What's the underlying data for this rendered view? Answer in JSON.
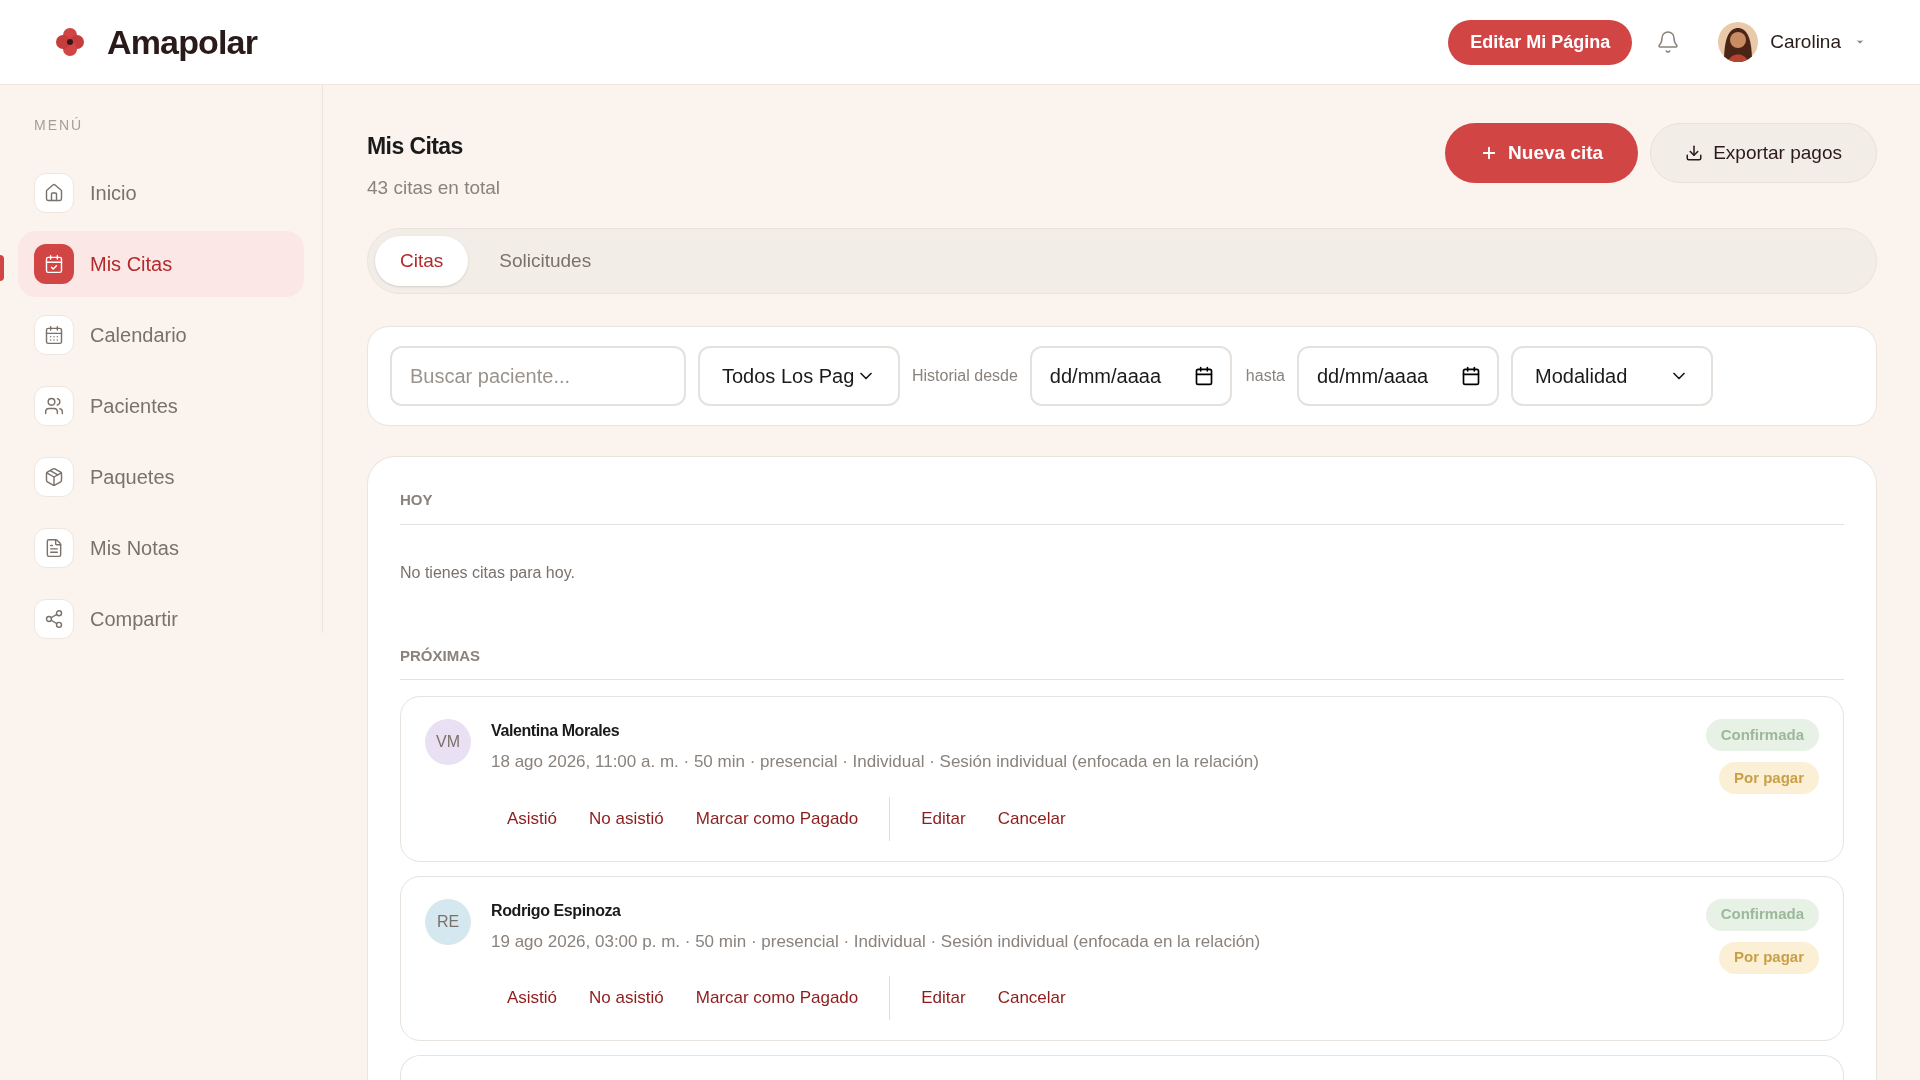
{
  "brand": {
    "name": "Amapolar"
  },
  "header": {
    "edit_button": "Editar Mi Página",
    "user": {
      "name": "Carolina"
    }
  },
  "sidebar": {
    "heading": "MENÚ",
    "items": [
      {
        "label": "Inicio",
        "selected": false
      },
      {
        "label": "Mis Citas",
        "selected": true
      },
      {
        "label": "Calendario",
        "selected": false
      },
      {
        "label": "Pacientes",
        "selected": false
      },
      {
        "label": "Paquetes",
        "selected": false
      },
      {
        "label": "Mis Notas",
        "selected": false
      },
      {
        "label": "Compartir",
        "selected": false
      }
    ]
  },
  "page": {
    "title": "Mis Citas",
    "subtitle": "43 citas en total",
    "new_button": "Nueva cita",
    "export_button": "Exportar pagos"
  },
  "tabs": [
    {
      "label": "Citas",
      "selected": true
    },
    {
      "label": "Solicitudes",
      "selected": false
    }
  ],
  "filters": {
    "search": {
      "placeholder": "Buscar paciente..."
    },
    "payment_select": "Todos Los Pag",
    "from_label": "Historial desde",
    "from_date": {
      "placeholder": "dd/mm/aaaa"
    },
    "to_label": "hasta",
    "to_date": {
      "placeholder": "dd/mm/aaaa"
    },
    "mode_select": "Modalidad"
  },
  "today": {
    "heading": "HOY",
    "empty_text": "No tienes citas para hoy."
  },
  "upcoming": {
    "heading": "PRÓXIMAS",
    "appointments": [
      {
        "initials": "VM",
        "color": "#e9e0f3",
        "name": "Valentina Morales",
        "details": "18 ago 2026, 11:00 a. m. · 50 min · presencial · Individual · Sesión individual (enfocada en la relación)",
        "badges": [
          {
            "label": "Confirmada",
            "kind": "status"
          },
          {
            "label": "Por pagar",
            "kind": "payment"
          }
        ],
        "actions": [
          "Asistió",
          "No asistió",
          "Marcar como Pagado"
        ],
        "secondary_actions": [
          "Editar",
          "Cancelar"
        ]
      },
      {
        "initials": "RE",
        "color": "#d6e8ef",
        "name": "Rodrigo Espinoza",
        "details": "19 ago 2026, 03:00 p. m. · 50 min · presencial · Individual · Sesión individual (enfocada en la relación)",
        "badges": [
          {
            "label": "Confirmada",
            "kind": "status"
          },
          {
            "label": "Por pagar",
            "kind": "payment"
          }
        ],
        "actions": [
          "Asistió",
          "No asistió",
          "Marcar como Pagado"
        ],
        "secondary_actions": [
          "Editar",
          "Cancelar"
        ]
      }
    ]
  }
}
